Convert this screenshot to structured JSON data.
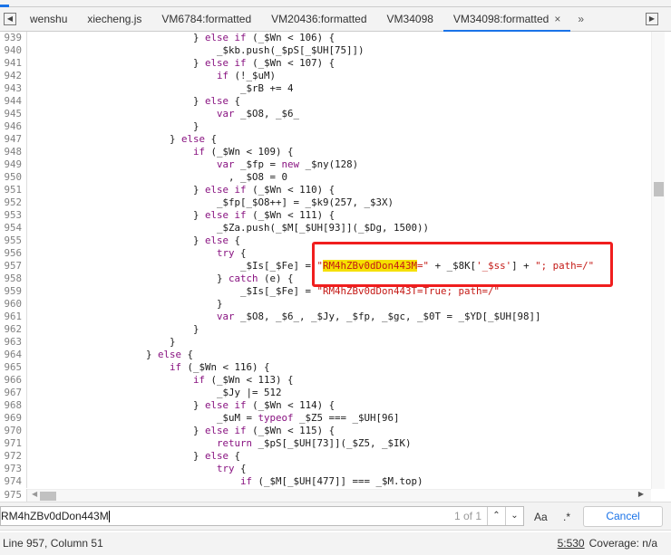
{
  "tabs": [
    {
      "label": "wenshu"
    },
    {
      "label": "xiecheng.js"
    },
    {
      "label": "VM6784:formatted"
    },
    {
      "label": "VM20436:formatted"
    },
    {
      "label": "VM34098"
    },
    {
      "label": "VM34098:formatted",
      "active": true
    }
  ],
  "close_glyph": "×",
  "more_glyph": "»",
  "code": {
    "highlight": "RM4hZBv0dDon443M",
    "highlight_line": 957,
    "lines": [
      {
        "n": "939",
        "t": "                            } else if (_$Wn < 106) {"
      },
      {
        "n": "940",
        "t": "                                _$kb.push(_$pS[_$UH[75]])"
      },
      {
        "n": "941",
        "t": "                            } else if (_$Wn < 107) {"
      },
      {
        "n": "942",
        "t": "                                if (!_$uM)"
      },
      {
        "n": "943",
        "t": "                                    _$rB += 4"
      },
      {
        "n": "944",
        "t": "                            } else {"
      },
      {
        "n": "945",
        "t": "                                var _$O8, _$6_"
      },
      {
        "n": "946",
        "t": "                            }"
      },
      {
        "n": "947",
        "t": "                        } else {"
      },
      {
        "n": "948",
        "t": "                            if (_$Wn < 109) {"
      },
      {
        "n": "949",
        "t": "                                var _$fp = new _$ny(128)"
      },
      {
        "n": "950",
        "t": "                                  , _$O8 = 0"
      },
      {
        "n": "951",
        "t": "                            } else if (_$Wn < 110) {"
      },
      {
        "n": "952",
        "t": "                                _$fp[_$O8++] = _$k9(257, _$3X)"
      },
      {
        "n": "953",
        "t": "                            } else if (_$Wn < 111) {"
      },
      {
        "n": "954",
        "t": "                                _$Za.push(_$M[_$UH[93]](_$Dg, 1500))"
      },
      {
        "n": "955",
        "t": "                            } else {"
      },
      {
        "n": "956",
        "t": "                                try {"
      },
      {
        "n": "957",
        "t": "                                    _$Is[_$Fe] = \"RM4hZBv0dDon443M=\" + _$8K['_$ss'] + \"; path=/\""
      },
      {
        "n": "958",
        "t": "                                } catch (e) {"
      },
      {
        "n": "959",
        "t": "                                    _$Is[_$Fe] = \"RM4hZBv0dDon443T=True; path=/\""
      },
      {
        "n": "960",
        "t": "                                }"
      },
      {
        "n": "961",
        "t": "                                var _$O8, _$6_, _$Jy, _$fp, _$gc, _$0T = _$YD[_$UH[98]]"
      },
      {
        "n": "962",
        "t": "                            }"
      },
      {
        "n": "963",
        "t": "                        }"
      },
      {
        "n": "964",
        "t": "                    } else {"
      },
      {
        "n": "965",
        "t": "                        if (_$Wn < 116) {"
      },
      {
        "n": "966",
        "t": "                            if (_$Wn < 113) {"
      },
      {
        "n": "967",
        "t": "                                _$Jy |= 512"
      },
      {
        "n": "968",
        "t": "                            } else if (_$Wn < 114) {"
      },
      {
        "n": "969",
        "t": "                                _$uM = typeof _$Z5 === _$UH[96]"
      },
      {
        "n": "970",
        "t": "                            } else if (_$Wn < 115) {"
      },
      {
        "n": "971",
        "t": "                                return _$pS[_$UH[73]](_$Z5, _$IK)"
      },
      {
        "n": "972",
        "t": "                            } else {"
      },
      {
        "n": "973",
        "t": "                                try {"
      },
      {
        "n": "974",
        "t": "                                    if (_$M[_$UH[477]] === _$M.top)"
      }
    ],
    "last_line_number": "975"
  },
  "search": {
    "value": "RM4hZBv0dDon443M",
    "match_count": "1 of 1",
    "match_case_label": "Aa",
    "regex_label": ".*",
    "cancel_label": "Cancel"
  },
  "status": {
    "position": "Line 957, Column 51",
    "selection": "5:530",
    "coverage": "Coverage: n/a"
  }
}
